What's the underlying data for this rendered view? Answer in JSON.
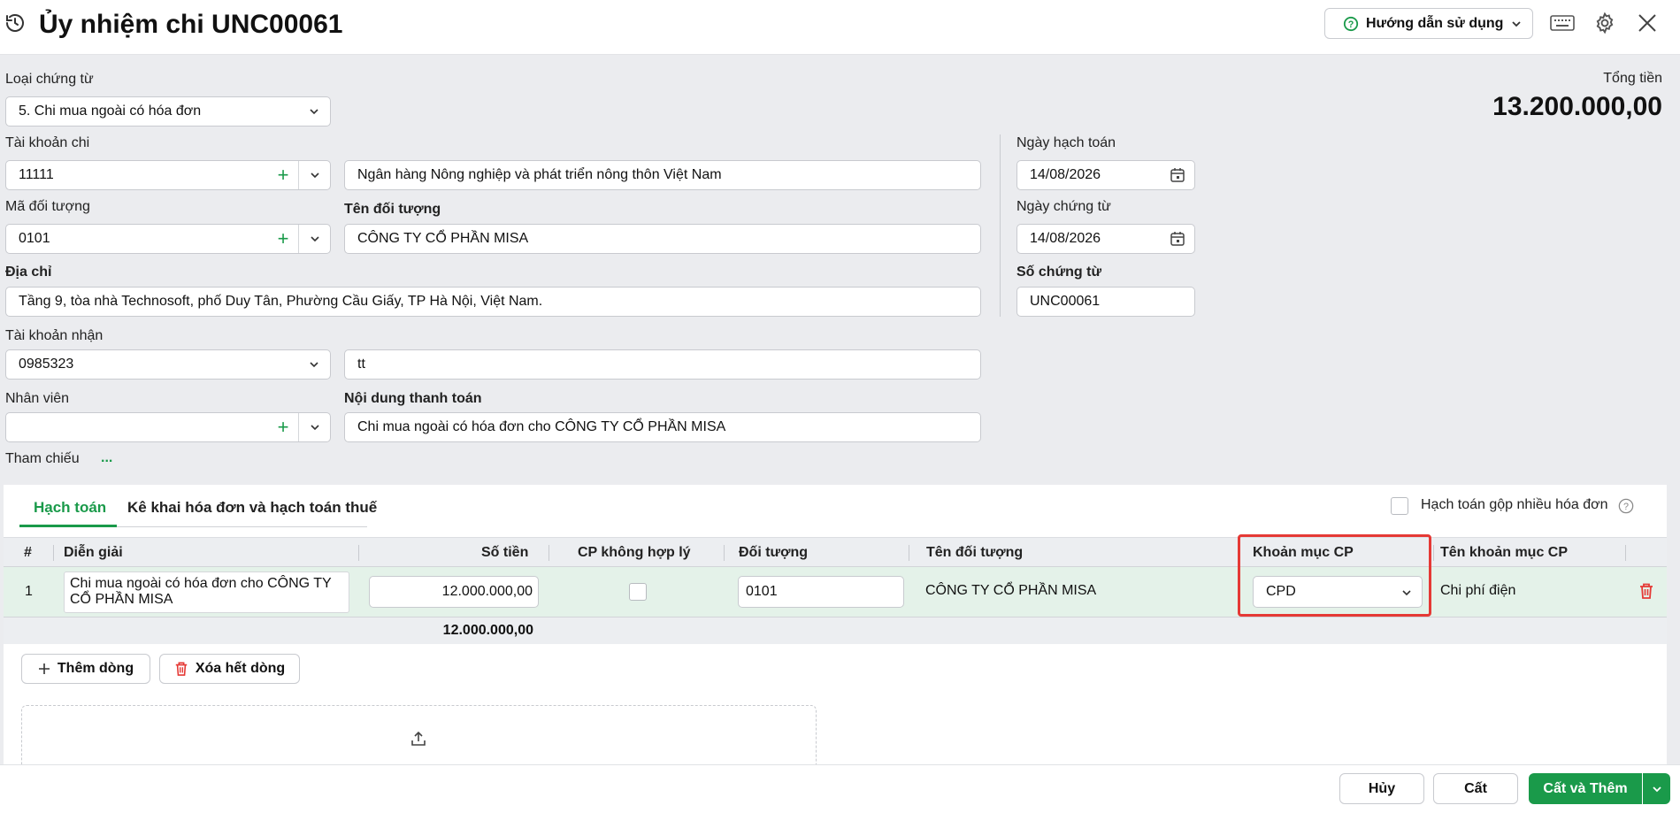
{
  "header": {
    "title": "Ủy nhiệm chi UNC00061",
    "help_label": "Hướng dẫn sử dụng"
  },
  "form": {
    "voucher_type_label": "Loại chứng từ",
    "voucher_type_value": "5. Chi mua ngoài có hóa đơn",
    "total_label": "Tổng tiền",
    "total_value": "13.200.000,00",
    "pay_account_label": "Tài khoản chi",
    "pay_account_value": "11111",
    "bank_name_value": "Ngân hàng Nông nghiệp và phát triển nông thôn Việt Nam",
    "object_code_label": "Mã đối tượng",
    "object_code_value": "0101",
    "object_name_label": "Tên đối tượng",
    "object_name_value": "CÔNG TY CỔ PHẦN MISA",
    "address_label": "Địa chỉ",
    "address_value": "Tầng 9, tòa nhà Technosoft, phố Duy Tân, Phường Cầu Giấy, TP Hà Nội, Việt Nam.",
    "receive_account_label": "Tài khoản nhận",
    "receive_account_value": "0985323",
    "receive_bank_value": "tt",
    "employee_label": "Nhân viên",
    "employee_value": "",
    "payment_content_label": "Nội dung thanh toán",
    "payment_content_value": "Chi mua ngoài có hóa đơn cho  CÔNG TY CỔ PHẦN MISA",
    "reference_label": "Tham chiếu",
    "reference_more": "...",
    "posting_date_label": "Ngày hạch toán",
    "posting_date_value": "14/08/2026",
    "voucher_date_label": "Ngày chứng từ",
    "voucher_date_value": "14/08/2026",
    "voucher_no_label": "Số chứng từ",
    "voucher_no_value": "UNC00061"
  },
  "tabs": {
    "accounting": "Hạch toán",
    "invoice_tax": "Kê khai hóa đơn và hạch toán thuế",
    "merge_label": "Hạch toán gộp nhiều hóa đơn"
  },
  "grid": {
    "columns": [
      "#",
      "Diễn giải",
      "Số tiền",
      "CP không hợp lý",
      "Đối tượng",
      "Tên đối tượng",
      "Khoản mục CP",
      "Tên khoản mục CP"
    ],
    "row": {
      "index": "1",
      "description": "Chi mua ngoài có hóa đơn cho  CÔNG TY CỔ PHẦN MISA",
      "amount": "12.000.000,00",
      "object": "0101",
      "object_name": "CÔNG TY CỔ PHẦN MISA",
      "expense_item": "CPD",
      "expense_item_name": "Chi phí điện"
    },
    "sum_amount": "12.000.000,00"
  },
  "actions": {
    "add_row": "Thêm dòng",
    "delete_all": "Xóa hết dòng",
    "cancel": "Hủy",
    "save": "Cất",
    "save_add": "Cất và Thêm"
  },
  "colors": {
    "accent": "#1a9a4a",
    "danger": "#e53935"
  }
}
